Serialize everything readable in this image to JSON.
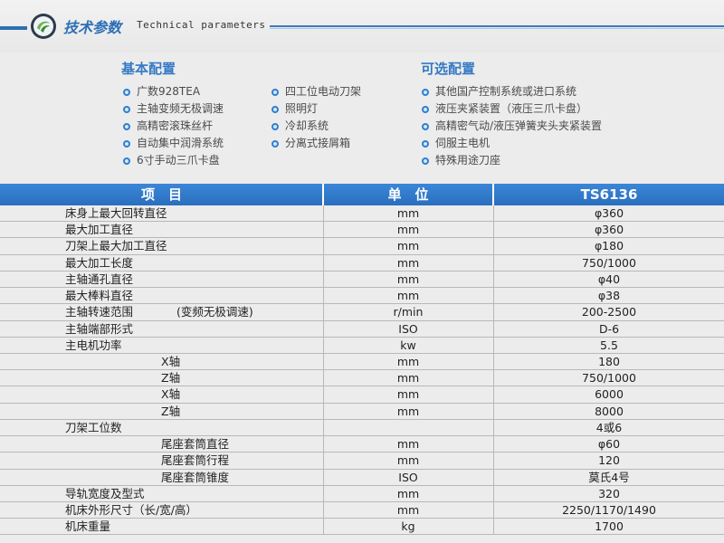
{
  "header": {
    "title_cn": "技术参数",
    "title_en": "Technical parameters"
  },
  "basic": {
    "title": "基本配置",
    "col1": [
      "广数928TEA",
      "主轴变频无极调速",
      "高精密滚珠丝杆",
      "自动集中润滑系统",
      "6寸手动三爪卡盘"
    ],
    "col2": [
      "四工位电动刀架",
      "照明灯",
      "冷却系统",
      "分离式接屑箱"
    ]
  },
  "optional": {
    "title": "可选配置",
    "items": [
      "其他国产控制系统或进口系统",
      "液压夹紧装置（液压三爪卡盘）",
      "高精密气动/液压弹簧夹头夹紧装置",
      "伺服主电机",
      "特殊用途刀座"
    ]
  },
  "table": {
    "headers": [
      "项　目",
      "单　位",
      "TS6136"
    ],
    "rows": [
      {
        "name": "床身上最大回转直径",
        "note": "",
        "unit": "mm",
        "value": "φ360"
      },
      {
        "name": "最大加工直径",
        "note": "",
        "unit": "mm",
        "value": "φ360"
      },
      {
        "name": "刀架上最大加工直径",
        "note": "",
        "unit": "mm",
        "value": "φ180"
      },
      {
        "name": "最大加工长度",
        "note": "",
        "unit": "mm",
        "value": "750/1000"
      },
      {
        "name": "主轴通孔直径",
        "note": "",
        "unit": "mm",
        "value": "φ40"
      },
      {
        "name": "最大棒料直径",
        "note": "",
        "unit": "mm",
        "value": "φ38"
      },
      {
        "name": "主轴转速范围",
        "note": "(变频无极调速)",
        "unit": "r/min",
        "value": "200-2500"
      },
      {
        "name": "主轴端部形式",
        "note": "",
        "unit": "ISO",
        "value": "D-6"
      },
      {
        "name": "主电机功率",
        "note": "",
        "unit": "kw",
        "value": "5.5"
      },
      {
        "name": "X轴",
        "note": "",
        "unit": "mm",
        "value": "180",
        "indent": true
      },
      {
        "name": "Z轴",
        "note": "",
        "unit": "mm",
        "value": "750/1000",
        "indent": true
      },
      {
        "name": "X轴",
        "note": "",
        "unit": "mm",
        "value": "6000",
        "indent": true
      },
      {
        "name": "Z轴",
        "note": "",
        "unit": "mm",
        "value": "8000",
        "indent": true
      },
      {
        "name": "刀架工位数",
        "note": "",
        "unit": "",
        "value": "4或6"
      },
      {
        "name": "尾座套筒直径",
        "note": "",
        "unit": "mm",
        "value": "φ60",
        "indent": true
      },
      {
        "name": "尾座套筒行程",
        "note": "",
        "unit": "mm",
        "value": "120",
        "indent": true
      },
      {
        "name": "尾座套筒锥度",
        "note": "",
        "unit": "ISO",
        "value": "莫氏4号",
        "indent": true
      },
      {
        "name": "导轨宽度及型式",
        "note": "",
        "unit": "mm",
        "value": "320"
      },
      {
        "name": "机床外形尺寸（长/宽/高）",
        "note": "",
        "unit": "mm",
        "value": "2250/1170/1490"
      },
      {
        "name": "机床重量",
        "note": "",
        "unit": "kg",
        "value": "1700"
      }
    ]
  }
}
